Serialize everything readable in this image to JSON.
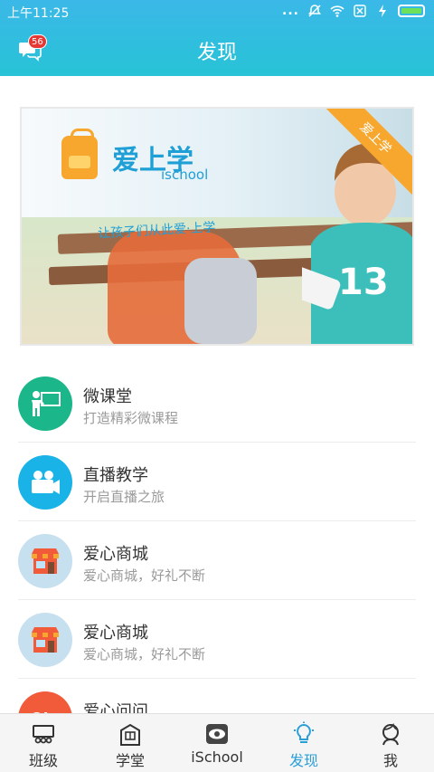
{
  "status": {
    "time": "上午11:25",
    "dots": "..."
  },
  "header": {
    "title": "发现",
    "message_badge": "56"
  },
  "banner": {
    "logo_text": "爱上学",
    "logo_en": "ischool",
    "slogan": "让孩子们从此爱·上学",
    "ribbon": "爱上学"
  },
  "list": {
    "items": [
      {
        "name": "微课堂",
        "desc": "打造精彩微课程",
        "color": "#1bb68a",
        "icon": "teacher-icon"
      },
      {
        "name": "直播教学",
        "desc": "开启直播之旅",
        "color": "#1ab3e8",
        "icon": "video-camera-icon"
      },
      {
        "name": "爱心商城",
        "desc": "爱心商城，好礼不断",
        "color": "#c7e0ef",
        "icon": "shop-icon"
      },
      {
        "name": "爱心商城",
        "desc": "爱心商城，好礼不断",
        "color": "#c7e0ef",
        "icon": "shop-icon"
      },
      {
        "name": "爱心问问",
        "desc": "",
        "color": "#f25b3a",
        "icon": "question-icon"
      }
    ]
  },
  "tabs": [
    {
      "label": "班级",
      "icon": "class-icon"
    },
    {
      "label": "学堂",
      "icon": "school-icon"
    },
    {
      "label": "iSchool",
      "icon": "eye-icon"
    },
    {
      "label": "发现",
      "icon": "bulb-icon",
      "active": true
    },
    {
      "label": "我",
      "icon": "person-icon"
    }
  ],
  "colors": {
    "header": "#2fbde0",
    "accent": "#2a9fd8"
  }
}
